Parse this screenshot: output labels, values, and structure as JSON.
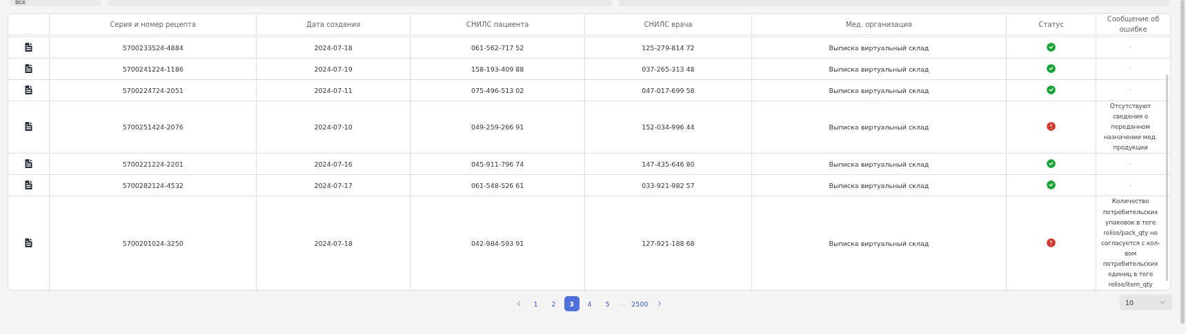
{
  "filters": [
    {
      "value": "Все"
    }
  ],
  "table": {
    "columns": [
      "",
      "Серия и номер рецепта",
      "Дата создания",
      "СНИЛС пациента",
      "СНИЛС врача",
      "Мед. организация",
      "Статус",
      "Сообщение об ошибке"
    ],
    "rows": [
      {
        "series": "5700233524-4884",
        "date": "2024-07-18",
        "patient_snils": "061-562-717 52",
        "doctor_snils": "125-279-814 72",
        "organization": "Выписка виртуальный склад",
        "failed": false,
        "error_message": "-"
      },
      {
        "series": "5700241224-1186",
        "date": "2024-07-19",
        "patient_snils": "158-193-409 88",
        "doctor_snils": "037-265-313 48",
        "organization": "Выписка виртуальный склад",
        "failed": false,
        "error_message": "-"
      },
      {
        "series": "5700224724-2051",
        "date": "2024-07-11",
        "patient_snils": "075-496-513 02",
        "doctor_snils": "047-017-699 58",
        "organization": "Выписка виртуальный склад",
        "failed": false,
        "error_message": "-"
      },
      {
        "series": "5700251424-2076",
        "date": "2024-07-10",
        "patient_snils": "049-259-266 91",
        "doctor_snils": "152-034-996 44",
        "organization": "Выписка виртуальный склад",
        "failed": true,
        "error_message": "Отсутствуют сведения о переданном назначении мед. продукции"
      },
      {
        "series": "5700221224-2201",
        "date": "2024-07-16",
        "patient_snils": "045-911-796 74",
        "doctor_snils": "147-435-646 80",
        "organization": "Выписка виртуальный склад",
        "failed": false,
        "error_message": "-"
      },
      {
        "series": "5700282124-4532",
        "date": "2024-07-17",
        "patient_snils": "061-548-526 61",
        "doctor_snils": "033-921-982 57",
        "organization": "Выписка виртуальный склад",
        "failed": false,
        "error_message": "-"
      },
      {
        "series": "5700201024-3250",
        "date": "2024-07-18",
        "patient_snils": "042-984-593 91",
        "doctor_snils": "127-921-188 68",
        "organization": "Выписка виртуальный склад",
        "failed": true,
        "error_message": "Количество потребительских упаковок в теге relise/pack_qty не согласуется с кол-вом потребительских единиц в теге relise/item_qty"
      }
    ]
  },
  "pagination": {
    "pages": [
      {
        "label": "1",
        "selected": false
      },
      {
        "label": "2",
        "selected": false
      },
      {
        "label": "3",
        "selected": true
      },
      {
        "label": "4",
        "selected": false
      },
      {
        "label": "5",
        "selected": false
      }
    ],
    "ellipsis": "...",
    "last": "2500"
  },
  "page_size": {
    "value": "10"
  }
}
